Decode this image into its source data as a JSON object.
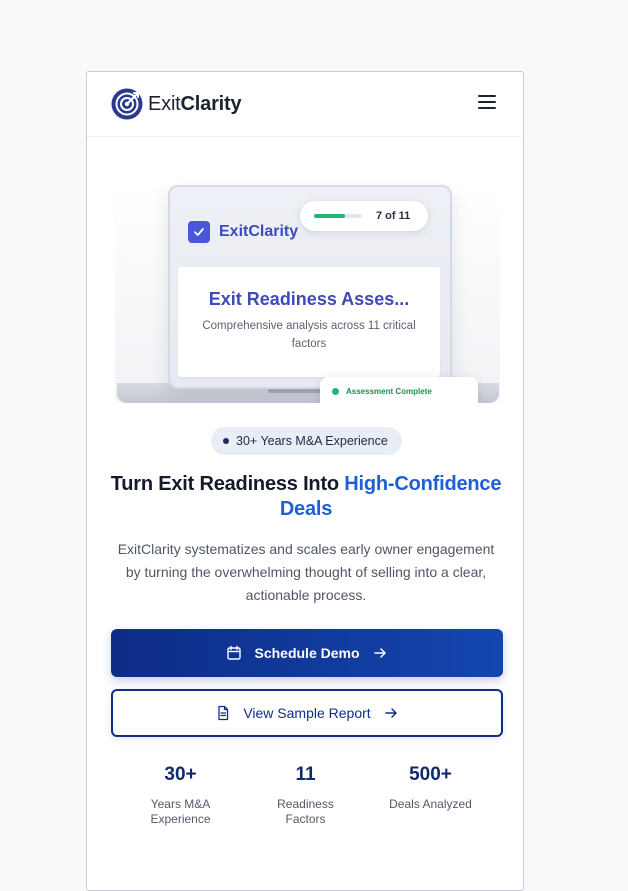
{
  "header": {
    "brand_part1": "Exit",
    "brand_part2": "Clarity",
    "logo_icon": "target-icon",
    "menu_icon": "hamburger-menu-icon"
  },
  "hero": {
    "screen_brand": "ExitClarity",
    "progress": {
      "label": "7 of 11",
      "completed": 7,
      "total": 11
    },
    "screen_title": "Exit Readiness Asses...",
    "screen_subtitle": "Comprehensive analysis across 11 critical factors",
    "toast_label": "Assessment Complete"
  },
  "badge": {
    "label": "30+ Years M&A Experience"
  },
  "headline": {
    "part1": "Turn Exit Readiness Into ",
    "accent": "High-Confidence Deals"
  },
  "description": "ExitClarity systematizes and scales early owner engagement by turning the overwhelming thought of selling into a clear, actionable process.",
  "cta": {
    "primary_label": "Schedule Demo",
    "primary_icon": "calendar-icon",
    "secondary_label": "View Sample Report",
    "secondary_icon": "document-icon",
    "arrow_icon": "arrow-right-icon"
  },
  "stats": [
    {
      "value": "30+",
      "label": "Years M&A Experience"
    },
    {
      "value": "11",
      "label": "Readiness Factors"
    },
    {
      "value": "500+",
      "label": "Deals Analyzed"
    }
  ],
  "colors": {
    "brand_blue": "#1f5fd6",
    "primary_dark": "#0d2c86",
    "success_green": "#22b573",
    "text_dark": "#141a29"
  }
}
